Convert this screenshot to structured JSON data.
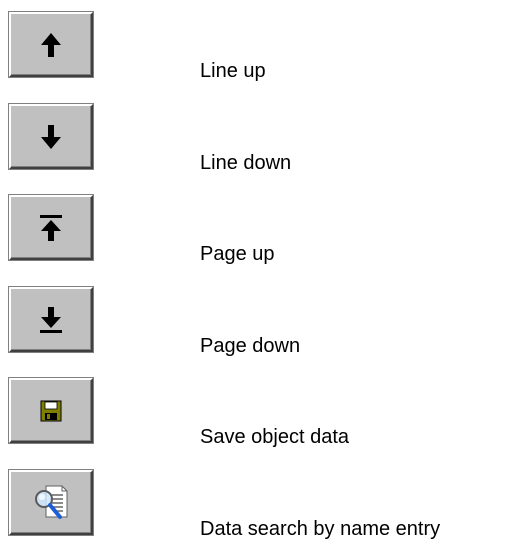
{
  "items": [
    {
      "icon": "arrow-up-icon",
      "label": "Line up"
    },
    {
      "icon": "arrow-down-icon",
      "label": "Line down"
    },
    {
      "icon": "page-up-icon",
      "label": "Page up"
    },
    {
      "icon": "page-down-icon",
      "label": "Page down"
    },
    {
      "icon": "save-disk-icon",
      "label": "Save object data"
    },
    {
      "icon": "document-search-icon",
      "label": "Data search by name entry"
    }
  ],
  "colors": {
    "button_face": "#c0c0c0",
    "icon_black": "#000000",
    "disk_olive": "#808000",
    "magnifier_blue": "#1e5fd8"
  }
}
